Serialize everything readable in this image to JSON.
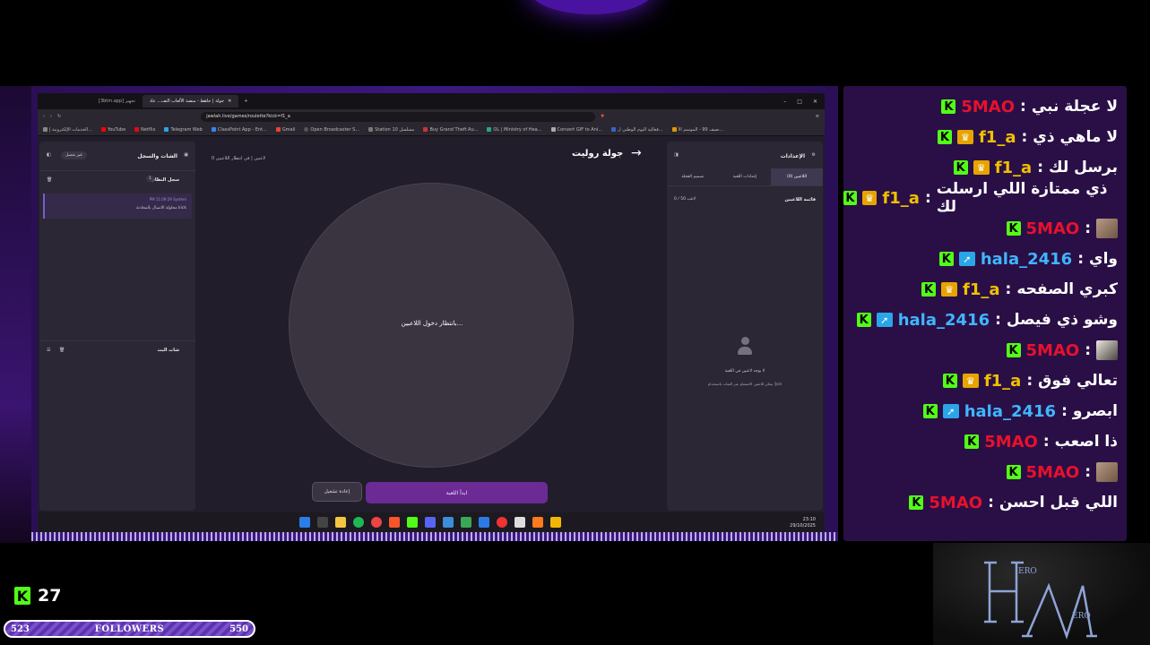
{
  "browser": {
    "tabs": [
      {
        "label": "[3btm.app] تجهيز"
      },
      {
        "label": "جولة | جاهط - منصة الألعاب التف... عاد"
      }
    ],
    "url": "jawlah.live/games/roulette?kick=f1_a",
    "bookmarks": [
      "الخدمات الإلكترونية إ...",
      "YouTube",
      "Netflix",
      "Telegram Web",
      "ClassPoint App - Ent...",
      "Gmail",
      "Open Broadcaster S...",
      "Station 10 مسلسل",
      "Buy Grand Theft Au...",
      "OL | Ministry of Hea...",
      "Convert GIF to Ani...",
      "فعالية اليوم الوطني ل...",
      "صيف 99 - الموسم الأ..."
    ]
  },
  "app": {
    "left_panel": {
      "title": "الشات والسجل",
      "toggle_label": "غير متصل",
      "log_title": "سجل النظام",
      "log_count": "1",
      "log_meta": "PM 11:09:29 System",
      "log_message": "محاولة الاتصال بالمحادثة kick",
      "bot_title": "شات البث"
    },
    "center": {
      "title": "جولة روليت",
      "status": "0 لاعبين | في انتظار اللاعبين",
      "waiting": "بانتظار دخول اللاعبين...",
      "start_button": "ابدأ اللعبة",
      "reset_button": "إعادة تشغيل"
    },
    "right_panel": {
      "title": "الإعدادات",
      "tabs": [
        "اللاعبين (0)",
        "إعدادات اللعبة",
        "تصميم العجلة"
      ],
      "players_title": "قائمة اللاعبين",
      "players_count": "0 / 50 لاعب",
      "empty_title": "لا يوجد لاعبين في اللعبة",
      "empty_sub": "يمكن للاعبين الانضمام عبر الشات باستخدام !join"
    }
  },
  "taskbar": {
    "time": "23:10",
    "date": "29/10/2025"
  },
  "chat": {
    "messages": [
      {
        "user": "5MAO",
        "user_color": "#e8112d",
        "badge": "none",
        "text": "لا عجلة نبي"
      },
      {
        "user": "f1_a",
        "user_color": "#f0c000",
        "badge": "crown",
        "text": "لا ماهي ذي"
      },
      {
        "user": "f1_a",
        "user_color": "#f0c000",
        "badge": "crown",
        "text": "برسل لك"
      },
      {
        "user": "f1_a",
        "user_color": "#f0c000",
        "badge": "crown",
        "text": "ذي ممتازة اللي ارسلت لك"
      },
      {
        "user": "5MAO",
        "user_color": "#e8112d",
        "badge": "avatar",
        "text": ""
      },
      {
        "user": "hala_2416",
        "user_color": "#3fb6ff",
        "badge": "vip",
        "text": "واي"
      },
      {
        "user": "f1_a",
        "user_color": "#f0c000",
        "badge": "crown",
        "text": "كبري الصفحه"
      },
      {
        "user": "hala_2416",
        "user_color": "#3fb6ff",
        "badge": "vip",
        "text": "وشو ذي فيصل"
      },
      {
        "user": "5MAO",
        "user_color": "#e8112d",
        "badge": "avatar-alt",
        "text": ""
      },
      {
        "user": "f1_a",
        "user_color": "#f0c000",
        "badge": "crown",
        "text": "تعالي فوق"
      },
      {
        "user": "hala_2416",
        "user_color": "#3fb6ff",
        "badge": "vip",
        "text": "ابصرو"
      },
      {
        "user": "5MAO",
        "user_color": "#e8112d",
        "badge": "none",
        "text": "ذا اصعب"
      },
      {
        "user": "5MAO",
        "user_color": "#e8112d",
        "badge": "avatar",
        "text": ""
      },
      {
        "user": "5MAO",
        "user_color": "#e8112d",
        "badge": "none",
        "text": "اللي قبل احسن"
      }
    ]
  },
  "overlay": {
    "viewer_count": "27",
    "followers_label": "FOLLOWERS",
    "followers_current": "523",
    "followers_goal": "550",
    "colors": {
      "kick_green": "#53fc18",
      "accent_purple": "#6b2a94"
    }
  }
}
